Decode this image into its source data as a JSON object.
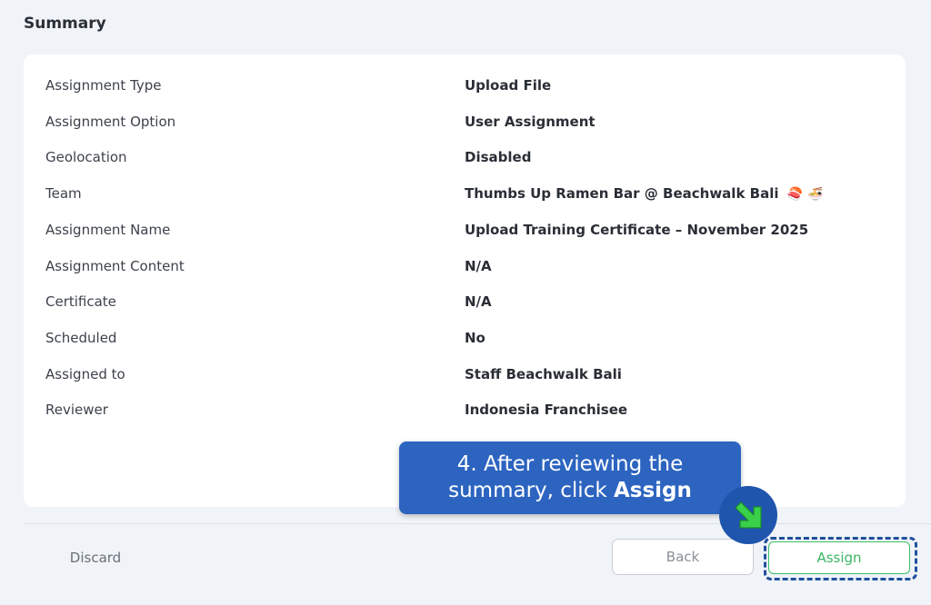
{
  "title": "Summary",
  "summary": [
    {
      "label": "Assignment Type",
      "value": "Upload File"
    },
    {
      "label": "Assignment Option",
      "value": "User Assignment"
    },
    {
      "label": "Geolocation",
      "value": "Disabled"
    },
    {
      "label": "Team",
      "value": "Thumbs Up Ramen Bar @ Beachwalk Bali",
      "emoji": "🍣 🍜"
    },
    {
      "label": "Assignment Name",
      "value": "Upload Training Certificate – November 2025"
    },
    {
      "label": "Assignment Content",
      "value": "N/A"
    },
    {
      "label": "Certificate",
      "value": "N/A"
    },
    {
      "label": "Scheduled",
      "value": "No"
    },
    {
      "label": "Assigned to",
      "value": "Staff Beachwalk Bali"
    },
    {
      "label": "Reviewer",
      "value": "Indonesia Franchisee"
    }
  ],
  "footer": {
    "discard_label": "Discard",
    "back_label": "Back",
    "assign_label": "Assign"
  },
  "callout": {
    "line1": "4. After reviewing the",
    "line2_prefix": "summary, click ",
    "line2_bold": "Assign"
  },
  "icons": {
    "pointer": "arrow-down-right-icon"
  },
  "colors": {
    "callout_bg": "#2c64c0",
    "assign_green": "#3cb565",
    "highlight_dashed": "#1f4f9c"
  }
}
